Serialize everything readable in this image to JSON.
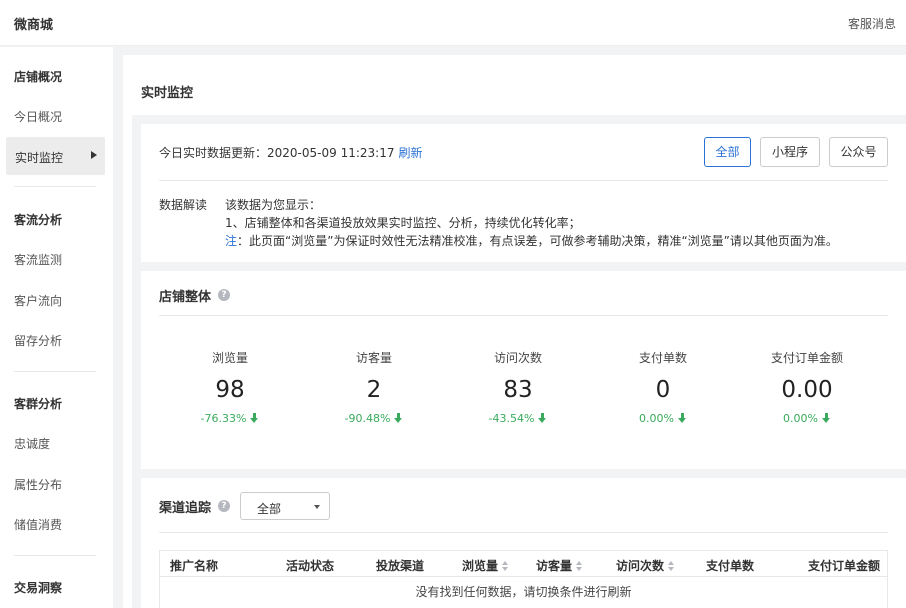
{
  "header": {
    "brand": "微商城",
    "service": "客服消息"
  },
  "sidebar": {
    "groups": [
      {
        "title": "店铺概况",
        "items": [
          "今日概况",
          "实时监控"
        ]
      },
      {
        "title": "客流分析",
        "items": [
          "客流监测",
          "客户流向",
          "留存分析"
        ]
      },
      {
        "title": "客群分析",
        "items": [
          "忠诚度",
          "属性分布",
          "储值消费"
        ]
      },
      {
        "title": "交易洞察",
        "items": []
      }
    ],
    "active_item": "实时监控"
  },
  "page": {
    "title": "实时监控"
  },
  "realtime": {
    "update_prefix": "今日实时数据更新：",
    "update_time": "2020-05-09 11:23:17",
    "refresh": "刷新",
    "filters": [
      "全部",
      "小程序",
      "公众号"
    ],
    "selected_filter": "全部"
  },
  "interpretation": {
    "label": "数据解读",
    "line1": "该数据为您显示：",
    "line2": "1、店铺整体和各渠道投放效果实时监控、分析，持续优化转化率；",
    "note_prefix": "注",
    "note_text": "：此页面“浏览量”为保证时效性无法精准校准，有点误差，可做参考辅助决策，精准“浏览量”请以其他页面为准。"
  },
  "store_overall": {
    "title": "店铺整体",
    "metrics": [
      {
        "label": "浏览量",
        "value": "98",
        "change": "-76.33%"
      },
      {
        "label": "访客量",
        "value": "2",
        "change": "-90.48%"
      },
      {
        "label": "访问次数",
        "value": "83",
        "change": "-43.54%"
      },
      {
        "label": "支付单数",
        "value": "0",
        "change": "0.00%"
      },
      {
        "label": "支付订单金额",
        "value": "0.00",
        "change": "0.00%"
      }
    ]
  },
  "channel_tracking": {
    "title": "渠道追踪",
    "select_value": "全部",
    "columns": [
      "推广名称",
      "活动状态",
      "投放渠道",
      "浏览量",
      "访客量",
      "访问次数",
      "支付单数",
      "支付订单金额"
    ],
    "empty_text": "没有找到任何数据，请切换条件进行刷新"
  },
  "colors": {
    "accent": "#2b72d6",
    "down": "#3aab5c"
  },
  "icons": {
    "help": "question-circle-icon",
    "trend_down": "arrow-down-icon",
    "sort": "sort-icon",
    "caret": "caret-down-icon",
    "active_arrow": "caret-right-icon"
  }
}
